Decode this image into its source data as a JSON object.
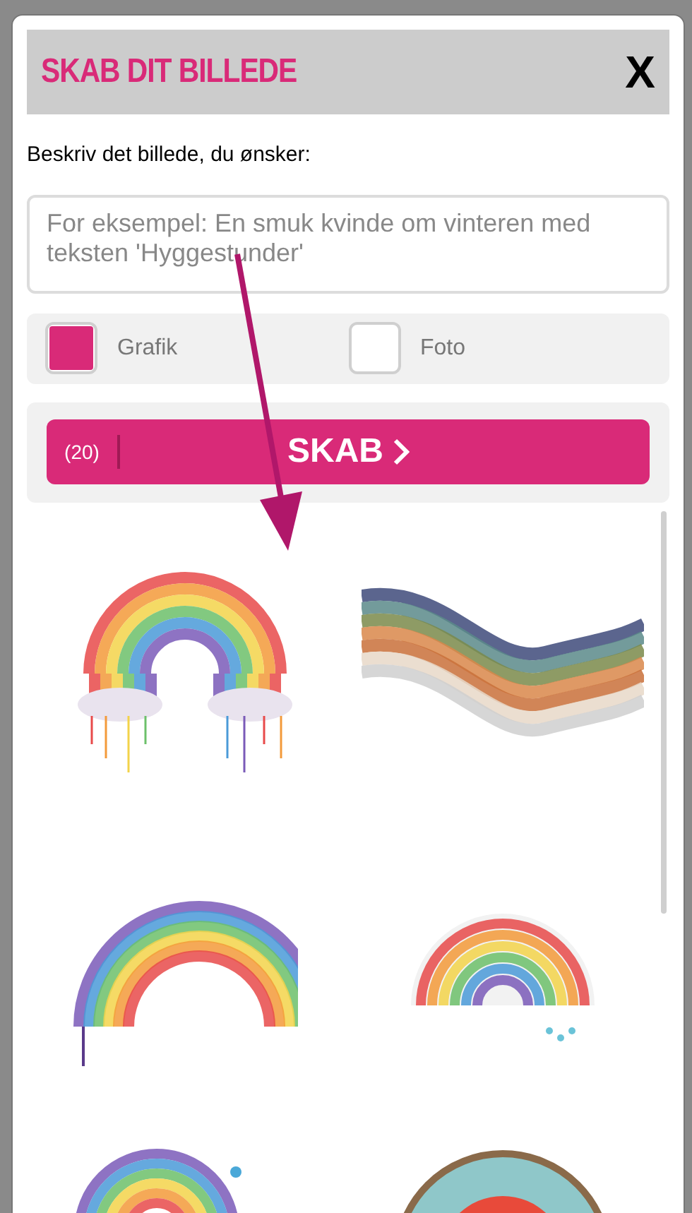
{
  "dialog": {
    "title": "SKAB DIT BILLEDE",
    "close": "X"
  },
  "prompt": {
    "label": "Beskriv det billede, du ønsker:",
    "placeholder": "For eksempel: En smuk kvinde om vinteren med teksten 'Hyggestunder'"
  },
  "styles": [
    {
      "label": "Grafik",
      "selected": true
    },
    {
      "label": "Foto",
      "selected": false
    }
  ],
  "create_button": {
    "count": "(20)",
    "label": "SKAB"
  },
  "results": [
    {
      "kind": "arch"
    },
    {
      "kind": "wave"
    },
    {
      "kind": "brush"
    },
    {
      "kind": "badge"
    },
    {
      "kind": "swirl"
    },
    {
      "kind": "stamp"
    }
  ]
}
